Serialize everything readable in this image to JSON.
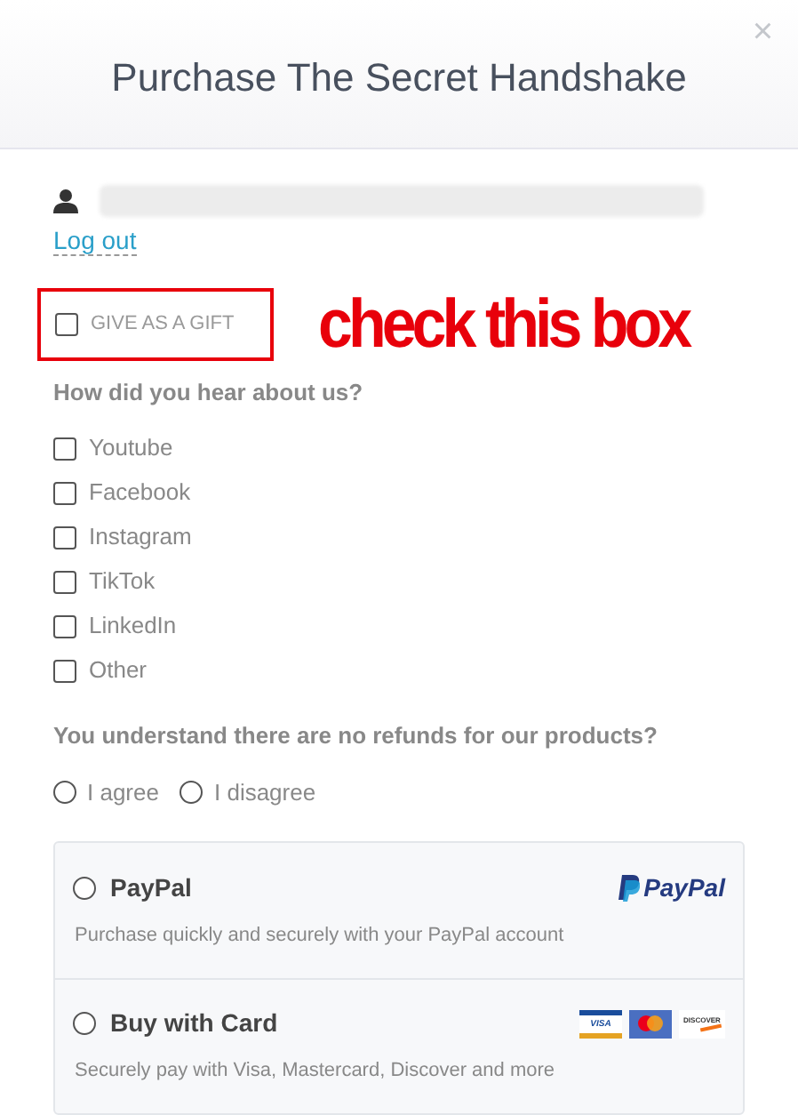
{
  "dialog": {
    "title": "Purchase The Secret Handshake",
    "close": "×"
  },
  "account": {
    "logout": "Log out"
  },
  "gift": {
    "label": "GIVE AS A GIFT",
    "checked": false
  },
  "annotation": {
    "text": "check this box"
  },
  "survey": {
    "question": "How did you hear about us?",
    "options": [
      {
        "label": "Youtube",
        "checked": false
      },
      {
        "label": "Facebook",
        "checked": false
      },
      {
        "label": "Instagram",
        "checked": false
      },
      {
        "label": "TikTok",
        "checked": false
      },
      {
        "label": "LinkedIn",
        "checked": false
      },
      {
        "label": "Other",
        "checked": false
      }
    ]
  },
  "refunds": {
    "question": "You understand there are no refunds for our products?",
    "options": [
      {
        "label": "I agree",
        "selected": false
      },
      {
        "label": "I disagree",
        "selected": false
      }
    ]
  },
  "payment_methods": [
    {
      "kind": "paypal",
      "title": "PayPal",
      "description": "Purchase quickly and securely with your PayPal account",
      "selected": false,
      "logos": [
        "PayPal"
      ]
    },
    {
      "kind": "card",
      "title": "Buy with Card",
      "description": "Securely pay with Visa, Mastercard, Discover and more",
      "selected": false,
      "logos": [
        "VISA",
        "DISCOVER"
      ]
    }
  ]
}
